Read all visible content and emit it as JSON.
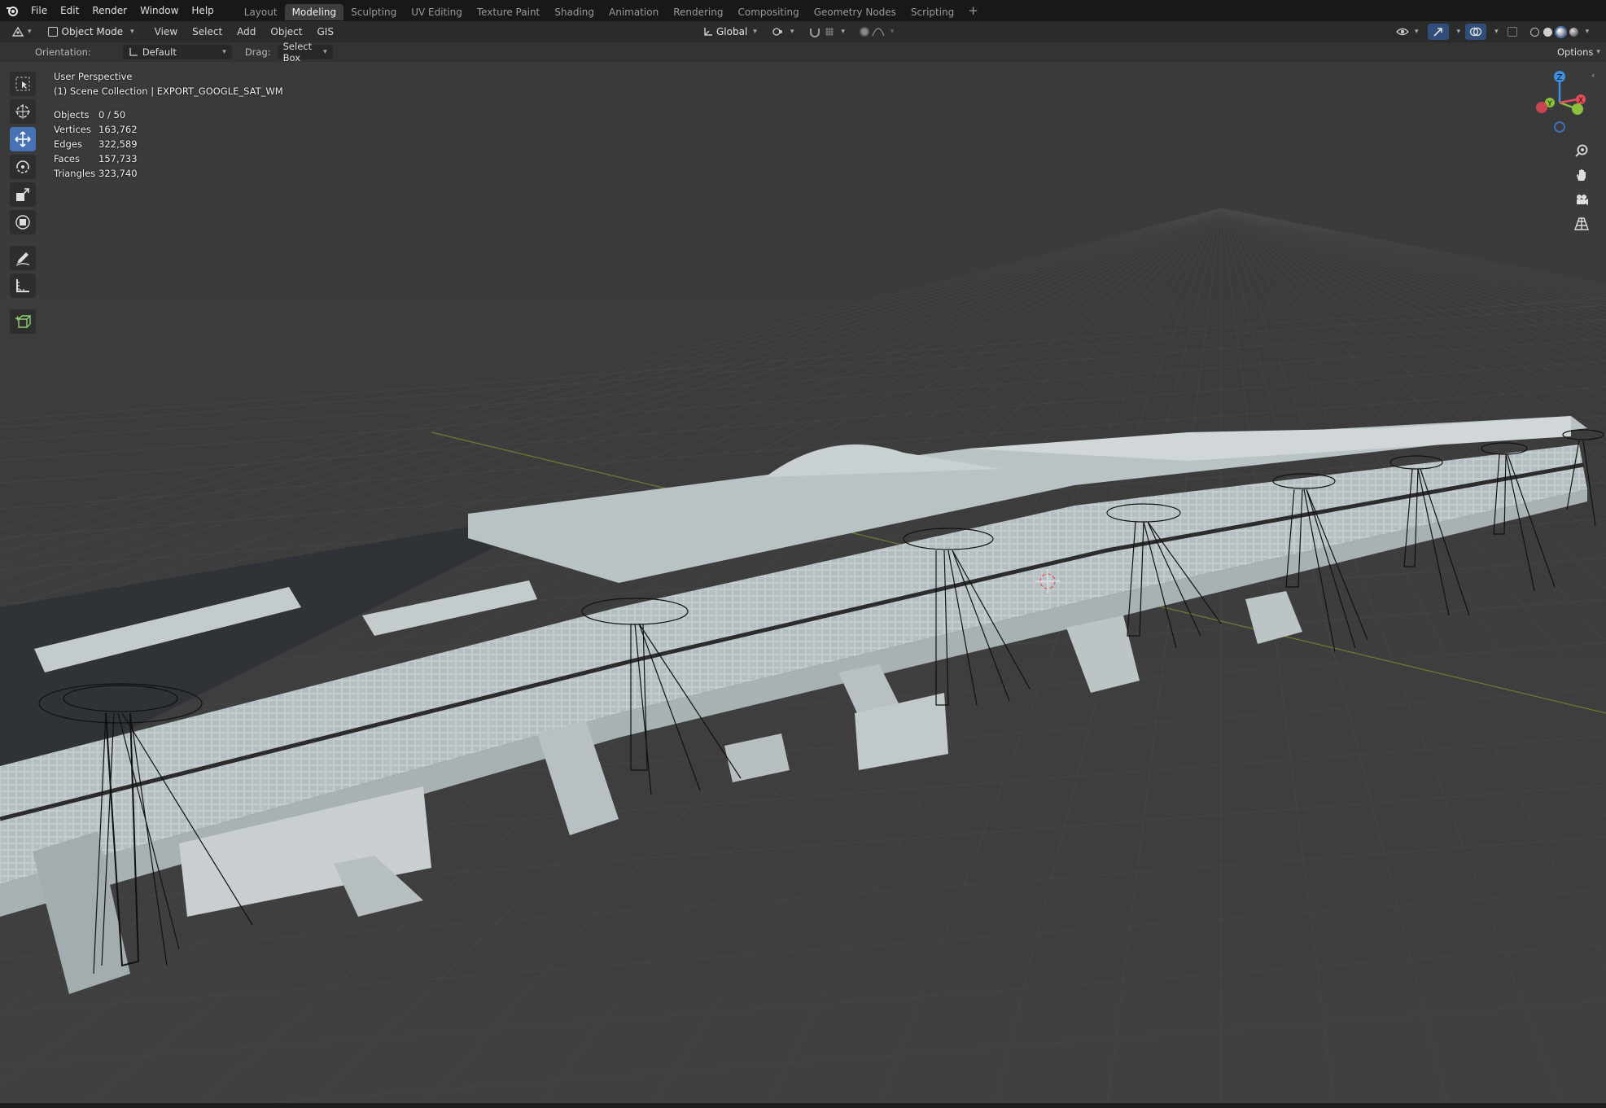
{
  "menubar": {
    "items": [
      "File",
      "Edit",
      "Render",
      "Window",
      "Help"
    ],
    "workspaces": [
      "Layout",
      "Modeling",
      "Sculpting",
      "UV Editing",
      "Texture Paint",
      "Shading",
      "Animation",
      "Rendering",
      "Compositing",
      "Geometry Nodes",
      "Scripting"
    ],
    "active_workspace": "Modeling",
    "add_label": "+"
  },
  "header": {
    "mode": "Object Mode",
    "menus": [
      "View",
      "Select",
      "Add",
      "Object",
      "GIS"
    ],
    "transform_orientation": "Global",
    "options_label": "Options"
  },
  "tool_settings": {
    "orientation_label": "Orientation:",
    "orientation_value": "Default",
    "drag_label": "Drag:",
    "drag_value": "Select Box"
  },
  "viewport": {
    "perspective": "User Perspective",
    "collection": "(1) Scene Collection | EXPORT_GOOGLE_SAT_WM",
    "stats": [
      {
        "label": "Objects",
        "value": "0 / 50"
      },
      {
        "label": "Vertices",
        "value": "163,762"
      },
      {
        "label": "Edges",
        "value": "322,589"
      },
      {
        "label": "Faces",
        "value": "157,733"
      },
      {
        "label": "Triangles",
        "value": "323,740"
      }
    ]
  },
  "toolbar": {
    "tools": [
      "select-box",
      "cursor",
      "move",
      "rotate",
      "scale",
      "transform",
      "annotate",
      "measure",
      "add-cube"
    ],
    "active_tool": "move"
  },
  "gizmo": {
    "axes": [
      "Z",
      "Y",
      "X"
    ],
    "colors": {
      "x": "#e44d5c",
      "y": "#8bbf3e",
      "z": "#3d8fe0"
    }
  },
  "colors": {
    "accent": "#4772b3",
    "background": "#3d3d3d",
    "topbar": "#181818"
  }
}
